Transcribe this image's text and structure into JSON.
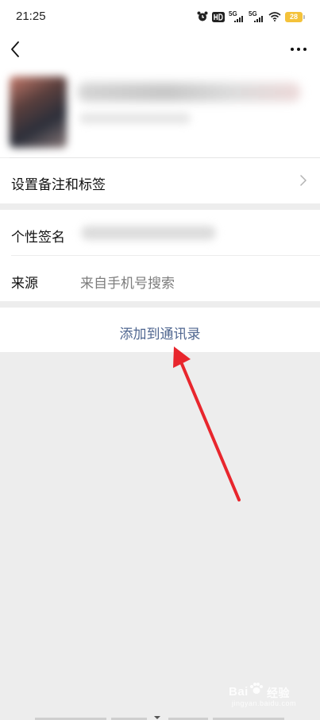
{
  "status_bar": {
    "time": "21:25",
    "network_1": "5G",
    "network_2": "5G",
    "battery": "28",
    "icons": [
      "alarm-icon",
      "hd-icon",
      "signal-icon",
      "signal-icon",
      "wifi-icon",
      "battery-icon"
    ]
  },
  "nav": {
    "back_icon": "chevron-left-icon",
    "more_icon": "more-dots-icon"
  },
  "profile": {
    "avatar": "blurred-avatar",
    "name": "",
    "subtitle": ""
  },
  "remark_row": {
    "label": "设置备注和标签",
    "chevron_icon": "chevron-right-icon"
  },
  "signature_row": {
    "label": "个性签名",
    "value": ""
  },
  "source_row": {
    "label": "来源",
    "value": "来自手机号搜索"
  },
  "add_contact": {
    "label": "添加到通讯录"
  },
  "watermark": {
    "brand": "Bai",
    "text": "经验",
    "url": "jingyan.baidu.com"
  },
  "colors": {
    "page_background": "#ededed",
    "card_background": "#ffffff",
    "link_blue": "#4f6690",
    "secondary_text": "#7d7d7d",
    "annotation_red": "#e8262d",
    "battery": "#f4c23a"
  }
}
